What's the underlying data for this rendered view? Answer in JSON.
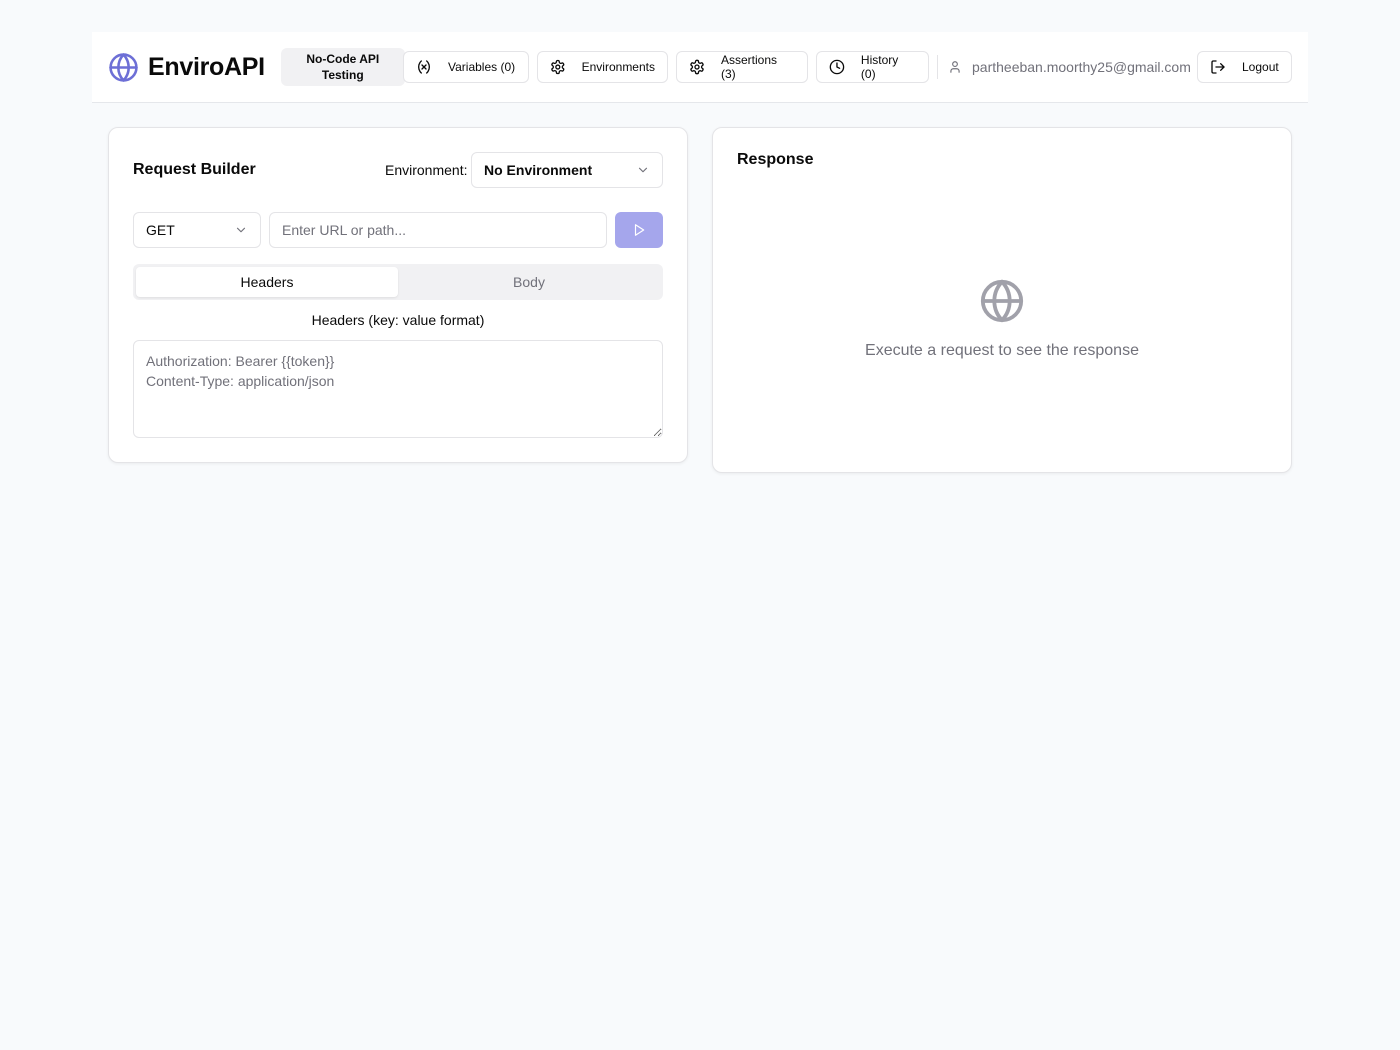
{
  "header": {
    "brand_title": "EnviroAPI",
    "badge_text": "No-Code API Testing",
    "nav": {
      "variables": "Variables (0)",
      "environments": "Environments",
      "assertions": "Assertions (3)",
      "history": "History (0)"
    },
    "user_email": "partheeban.moorthy25@gmail.com",
    "logout": "Logout"
  },
  "request_builder": {
    "title": "Request Builder",
    "environment_label": "Environment:",
    "environment_value": "No Environment",
    "method": "GET",
    "url_value": "",
    "url_placeholder": "Enter URL or path...",
    "tabs": [
      "Headers",
      "Body"
    ],
    "active_tab": "Headers",
    "headers_label": "Headers (key: value format)",
    "headers_value": "",
    "headers_placeholder": "Authorization: Bearer {{token}}\nContent-Type: application/json"
  },
  "response": {
    "title": "Response",
    "empty_text": "Execute a request to see the response"
  },
  "colors": {
    "accent": "#6d6fd6",
    "send_button": "#a5a6ec",
    "background": "#f8fafc"
  }
}
